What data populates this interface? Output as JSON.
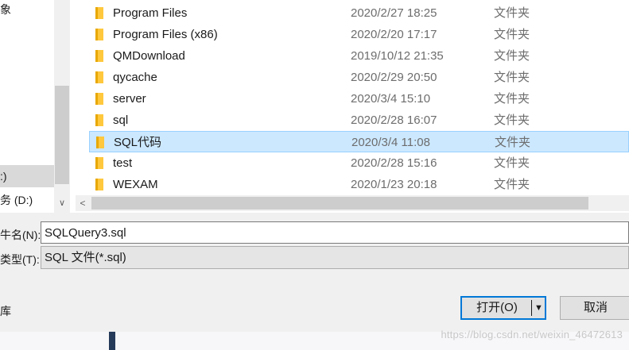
{
  "navigation": {
    "items": [
      {
        "label": "象",
        "selected": false
      },
      {
        "label": ":)",
        "selected": true
      },
      {
        "label": "务 (D:)",
        "selected": false
      }
    ]
  },
  "file_list": {
    "rows": [
      {
        "name": "Program Files",
        "date": "2020/2/27 18:25",
        "type": "文件夹",
        "selected": false
      },
      {
        "name": "Program Files (x86)",
        "date": "2020/2/20 17:17",
        "type": "文件夹",
        "selected": false
      },
      {
        "name": "QMDownload",
        "date": "2019/10/12 21:35",
        "type": "文件夹",
        "selected": false
      },
      {
        "name": "qycache",
        "date": "2020/2/29 20:50",
        "type": "文件夹",
        "selected": false
      },
      {
        "name": "server",
        "date": "2020/3/4 15:10",
        "type": "文件夹",
        "selected": false
      },
      {
        "name": "sql",
        "date": "2020/2/28 16:07",
        "type": "文件夹",
        "selected": false
      },
      {
        "name": "SQL代码",
        "date": "2020/3/4 11:08",
        "type": "文件夹",
        "selected": true
      },
      {
        "name": "test",
        "date": "2020/2/28 15:16",
        "type": "文件夹",
        "selected": false
      },
      {
        "name": "WEXAM",
        "date": "2020/1/23 20:18",
        "type": "文件夹",
        "selected": false
      }
    ]
  },
  "footer": {
    "filename_label": "牛名(N):",
    "filename_value": "SQLQuery3.sql",
    "filetype_label": "类型(T):",
    "filetype_value": "SQL 文件(*.sql)",
    "left_text": "库",
    "open_label": "打开(O)",
    "cancel_label": "取消"
  },
  "icons": {
    "folder": "folder-icon",
    "scroll_down": "chevron-down-icon",
    "scroll_left": "chevron-left-icon",
    "split_arrow": "triangle-down-icon"
  },
  "colors": {
    "folder": "#ffc83d",
    "selection_bg": "#cce8ff",
    "selection_border": "#99d1ff",
    "primary_border": "#0078d7"
  },
  "watermark": "https://blog.csdn.net/weixin_46472613"
}
